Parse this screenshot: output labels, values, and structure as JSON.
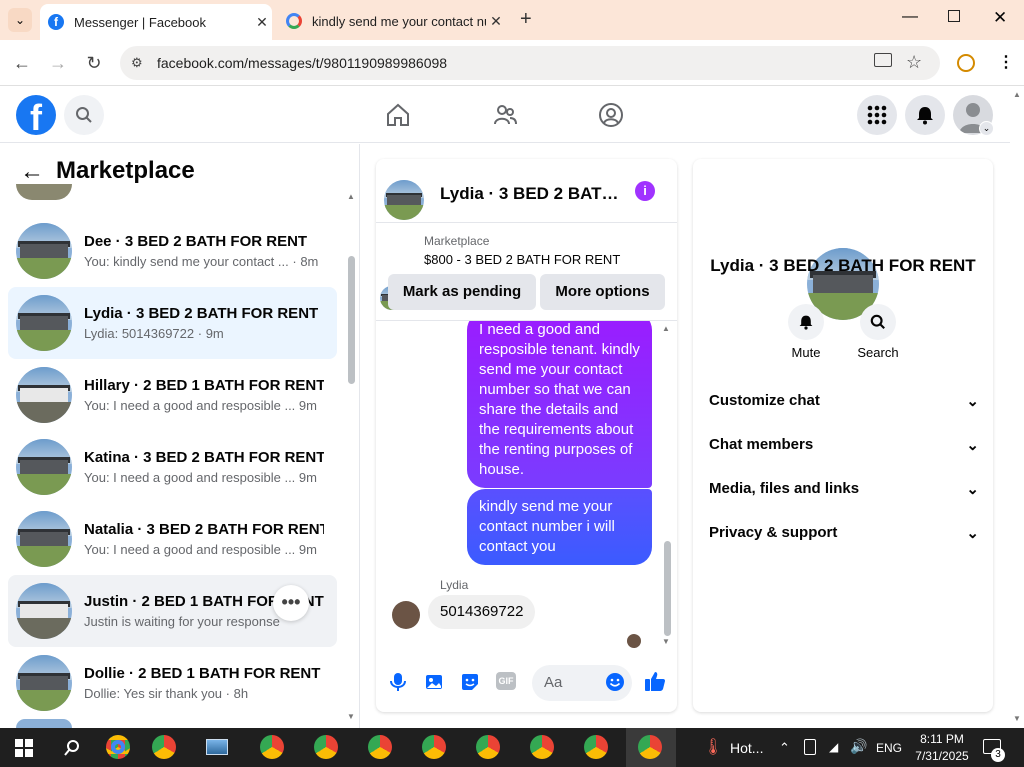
{
  "browser": {
    "tabs": [
      {
        "title": "Messenger | Facebook",
        "active": true
      },
      {
        "title": "kindly send me your contact nu",
        "active": false
      }
    ],
    "url": "facebook.com/messages/t/9801190989986098"
  },
  "left": {
    "title": "Marketplace",
    "conversations": [
      {
        "name": "Dee · 3 BED 2 BATH FOR RENT",
        "preview": "You: kindly send me your contact ...",
        "time": "· 8m",
        "thumb": "house"
      },
      {
        "name": "Lydia · 3 BED 2 BATH FOR RENT",
        "preview": "Lydia: 5014369722",
        "time": "· 9m",
        "thumb": "house",
        "selected": true
      },
      {
        "name": "Hillary · 2 BED 1 BATH FOR RENT",
        "preview": "You: I need a good and resposible ...",
        "time": "9m",
        "thumb": "white"
      },
      {
        "name": "Katina · 3 BED 2 BATH FOR RENT",
        "preview": "You: I need a good and resposible ...",
        "time": "9m",
        "thumb": "house"
      },
      {
        "name": "Natalia · 3 BED 2 BATH FOR RENT",
        "preview": "You: I need a good and resposible ...",
        "time": "9m",
        "thumb": "house"
      },
      {
        "name": "Justin · 2 BED 1 BATH FOR RENT",
        "preview": "Justin is waiting for your response",
        "time": "",
        "thumb": "white"
      },
      {
        "name": "Dollie · 2 BED 1 BATH FOR RENT",
        "preview": "Dollie: Yes sir thank you",
        "time": "· 8h",
        "thumb": "house"
      }
    ]
  },
  "chat": {
    "title": "Lydia · 3 BED 2 BATH...",
    "listing_label": "Marketplace",
    "listing_text": "$800 - 3 BED 2 BATH FOR RENT",
    "mark_pending": "Mark as pending",
    "more_options": "More options",
    "messages": [
      {
        "from": "me",
        "text": "I need a good and resposible tenant. kindly send me your contact number so that we can share the details and the requirements about the renting purposes of house."
      },
      {
        "from": "me",
        "text": "kindly send me your contact number i will contact you"
      }
    ],
    "reply_sender": "Lydia",
    "reply_text": "5014369722",
    "composer_placeholder": "Aa"
  },
  "right": {
    "name": "Lydia · 3 BED 2 BATH FOR RENT",
    "mute": "Mute",
    "search": "Search",
    "sections": [
      "Customize chat",
      "Chat members",
      "Media, files and links",
      "Privacy & support"
    ]
  },
  "taskbar": {
    "weather": "Hot...",
    "lang": "ENG",
    "time": "8:11 PM",
    "date": "7/31/2025",
    "notif": "3"
  }
}
